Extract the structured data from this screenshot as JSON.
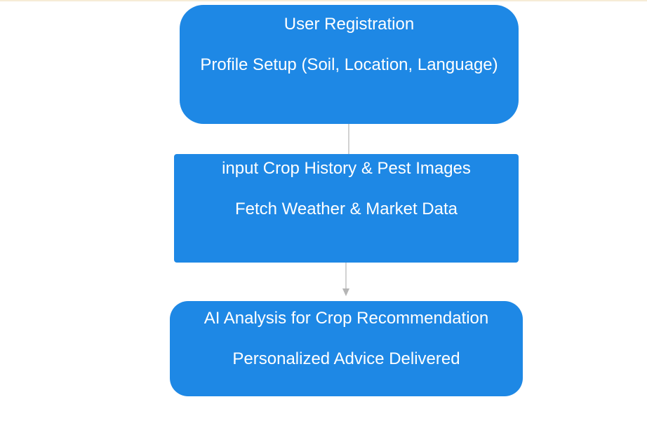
{
  "diagram": {
    "nodes": [
      {
        "line1": "User Registration",
        "line2": "Profile Setup (Soil, Location, Language)"
      },
      {
        "line1": "input Crop History & Pest Images",
        "line2": "Fetch Weather & Market Data"
      },
      {
        "line1": "AI Analysis for Crop Recommendation",
        "line2": "Personalized Advice Delivered"
      }
    ],
    "edges": [
      {
        "from": 0,
        "to": 1,
        "arrow": false
      },
      {
        "from": 1,
        "to": 2,
        "arrow": true
      }
    ]
  },
  "colors": {
    "node_fill": "#1e88e5",
    "node_text": "#ffffff",
    "connector": "#b5b5b5",
    "top_line": "#f6ecd6"
  }
}
